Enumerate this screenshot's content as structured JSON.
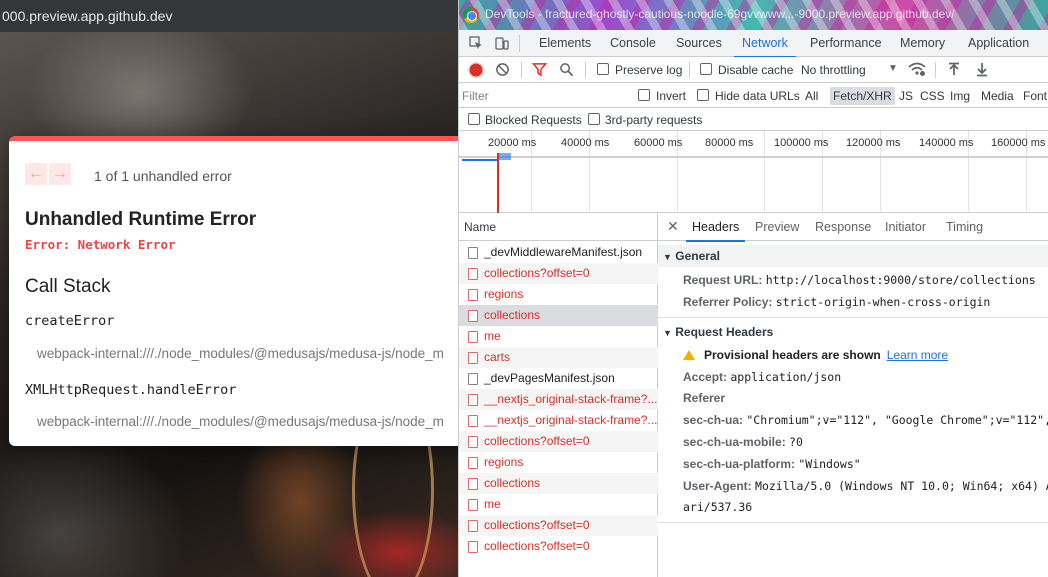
{
  "browser": {
    "url_fragment": "000.preview.app.github.dev"
  },
  "error_overlay": {
    "pager": "1 of 1 unhandled error",
    "title": "Unhandled Runtime Error",
    "message": "Error: Network Error",
    "call_stack_heading": "Call Stack",
    "frames": [
      {
        "function": "createError",
        "path": "webpack-internal:///./node_modules/@medusajs/medusa-js/node_m"
      },
      {
        "function": "XMLHttpRequest.handleError",
        "path": "webpack-internal:///./node_modules/@medusajs/medusa-js/node_m"
      }
    ]
  },
  "devtools": {
    "window_title": "DevTools - fractured-ghostly-cautious-noodle-69gvvwww...-9000.preview.app.github.dev/",
    "tabs": [
      "Elements",
      "Console",
      "Sources",
      "Network",
      "Performance",
      "Memory",
      "Application"
    ],
    "active_tab": "Network",
    "toolbar": {
      "preserve_log": "Preserve log",
      "disable_cache": "Disable cache",
      "throttling": "No throttling"
    },
    "filter": {
      "placeholder": "Filter",
      "invert": "Invert",
      "hide_data_urls": "Hide data URLs",
      "types": [
        "All",
        "Fetch/XHR",
        "JS",
        "CSS",
        "Img",
        "Media",
        "Font"
      ],
      "active_type": "Fetch/XHR",
      "blocked_requests": "Blocked Requests",
      "third_party": "3rd-party requests"
    },
    "timeline_ticks": [
      "20000 ms",
      "40000 ms",
      "60000 ms",
      "80000 ms",
      "100000 ms",
      "120000 ms",
      "140000 ms",
      "160000 ms"
    ],
    "request_list": {
      "header": "Name",
      "rows": [
        {
          "name": "_devMiddlewareManifest.json",
          "status": "ok"
        },
        {
          "name": "collections?offset=0",
          "status": "error"
        },
        {
          "name": "regions",
          "status": "error"
        },
        {
          "name": "collections",
          "status": "error",
          "selected": true
        },
        {
          "name": "me",
          "status": "error"
        },
        {
          "name": "carts",
          "status": "error"
        },
        {
          "name": "_devPagesManifest.json",
          "status": "ok"
        },
        {
          "name": "__nextjs_original-stack-frame?...",
          "status": "error"
        },
        {
          "name": "__nextjs_original-stack-frame?...",
          "status": "error"
        },
        {
          "name": "collections?offset=0",
          "status": "error"
        },
        {
          "name": "regions",
          "status": "error"
        },
        {
          "name": "collections",
          "status": "error"
        },
        {
          "name": "me",
          "status": "error"
        },
        {
          "name": "collections?offset=0",
          "status": "error"
        },
        {
          "name": "collections?offset=0",
          "status": "error"
        }
      ]
    },
    "details": {
      "tabs": [
        "Headers",
        "Preview",
        "Response",
        "Initiator",
        "Timing"
      ],
      "active_tab": "Headers",
      "general_heading": "General",
      "request_url_key": "Request URL:",
      "request_url": "http://localhost:9000/store/collections",
      "referrer_policy_key": "Referrer Policy:",
      "referrer_policy": "strict-origin-when-cross-origin",
      "request_headers_heading": "Request Headers",
      "provisional_warning": "Provisional headers are shown",
      "learn_more": "Learn more",
      "accept_key": "Accept:",
      "accept": "application/json",
      "referer_key": "Referer",
      "sec_ch_ua_key": "sec-ch-ua:",
      "sec_ch_ua": "\"Chromium\";v=\"112\", \"Google Chrome\";v=\"112\", \"",
      "sec_ch_ua_mobile_key": "sec-ch-ua-mobile:",
      "sec_ch_ua_mobile": "?0",
      "sec_ch_ua_platform_key": "sec-ch-ua-platform:",
      "sec_ch_ua_platform": "\"Windows\"",
      "user_agent_key": "User-Agent:",
      "user_agent": "Mozilla/5.0 (Windows NT 10.0; Win64; x64) Ap",
      "user_agent_cont": "ari/537.36"
    }
  },
  "colors": {
    "accent": "#1a73e8",
    "error_red": "#d93025",
    "overlay_red": "#ff5555",
    "warning": "#f9ab00"
  }
}
